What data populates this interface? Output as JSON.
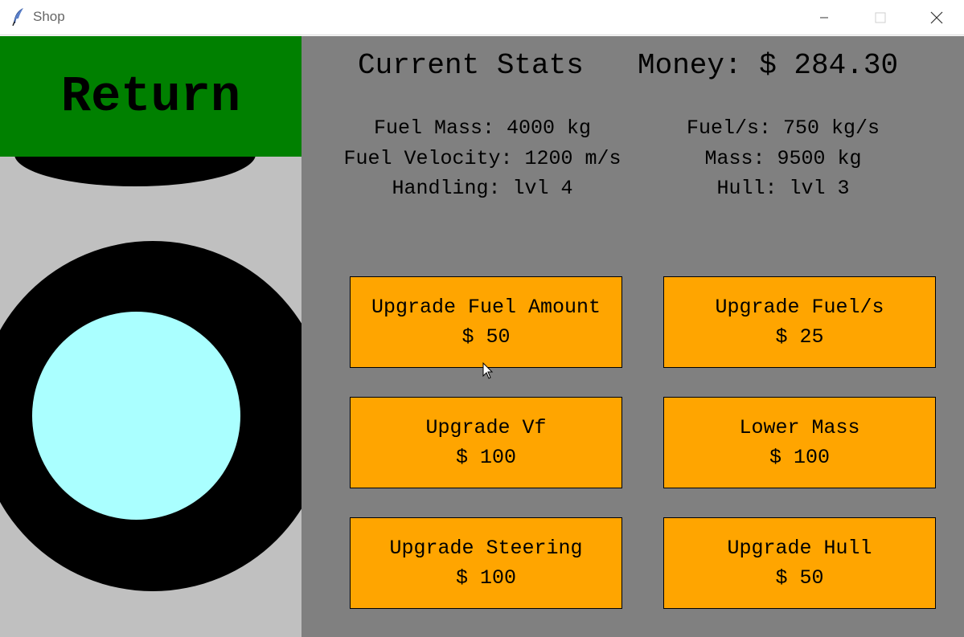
{
  "window": {
    "title": "Shop",
    "app_icon": "feather-icon",
    "controls": [
      "minimize-icon",
      "maximize-icon",
      "close-icon"
    ]
  },
  "left_panel": {
    "return_label": "Return"
  },
  "header": {
    "title": "Current Stats",
    "money": "Money: $ 284.30"
  },
  "stats": {
    "left": [
      "Fuel Mass: 4000 kg",
      "Fuel Velocity: 1200 m/s",
      "Handling: lvl 4"
    ],
    "right": [
      "Fuel/s: 750 kg/s",
      "Mass: 9500 kg",
      "Hull: lvl 3"
    ]
  },
  "upgrades": [
    {
      "label": "Upgrade Fuel Amount",
      "price": "$ 50"
    },
    {
      "label": "Upgrade Fuel/s",
      "price": "$ 25"
    },
    {
      "label": "Upgrade Vf",
      "price": "$ 100"
    },
    {
      "label": "Lower Mass",
      "price": "$ 100"
    },
    {
      "label": "Upgrade Steering",
      "price": "$ 100"
    },
    {
      "label": "Upgrade Hull",
      "price": "$ 50"
    }
  ],
  "colors": {
    "return_bg": "#008000",
    "button_bg": "#ffa500",
    "panel_bg": "#808080",
    "preview_bg": "#c0c0c0",
    "window_tint": "#aaffff"
  }
}
